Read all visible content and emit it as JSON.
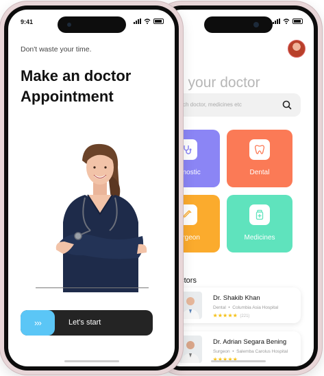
{
  "front": {
    "status_time": "9:41",
    "subtitle": "Don't waste your time.",
    "headline_line1": "Make an doctor",
    "headline_line2": "Appointment",
    "slider_arrows": "›››",
    "slider_label": "Let's start"
  },
  "back": {
    "find_prefix": "d",
    "find_rest": " your doctor",
    "search_placeholder": "ch doctor, medicines etc",
    "categories": [
      {
        "label": "iagnostic",
        "color": "#8b85f5",
        "icon": "stethoscope-icon"
      },
      {
        "label": "Dental",
        "color": "#fb7a56",
        "icon": "tooth-icon"
      },
      {
        "label": "Surgeon",
        "color": "#fbab2d",
        "icon": "syringe-icon"
      },
      {
        "label": "Medicines",
        "color": "#5fe3bd",
        "icon": "medicine-bottle-icon"
      }
    ],
    "section_title": "octors",
    "doctors": [
      {
        "name": "Dr. Shakib Khan",
        "specialty": "Dental",
        "hospital": "Columbia Asia Hospital",
        "stars": "★★★★★",
        "reviews": "(221)"
      },
      {
        "name": "Dr. Adrian Segara Bening",
        "specialty": "Surgeon",
        "hospital": "Salemba Carolus Hospital",
        "stars": "★★★★★",
        "reviews": ""
      }
    ]
  },
  "colors": {
    "accent": "#5bc6f6",
    "dark_button": "#242424",
    "star": "#f5c21b"
  }
}
